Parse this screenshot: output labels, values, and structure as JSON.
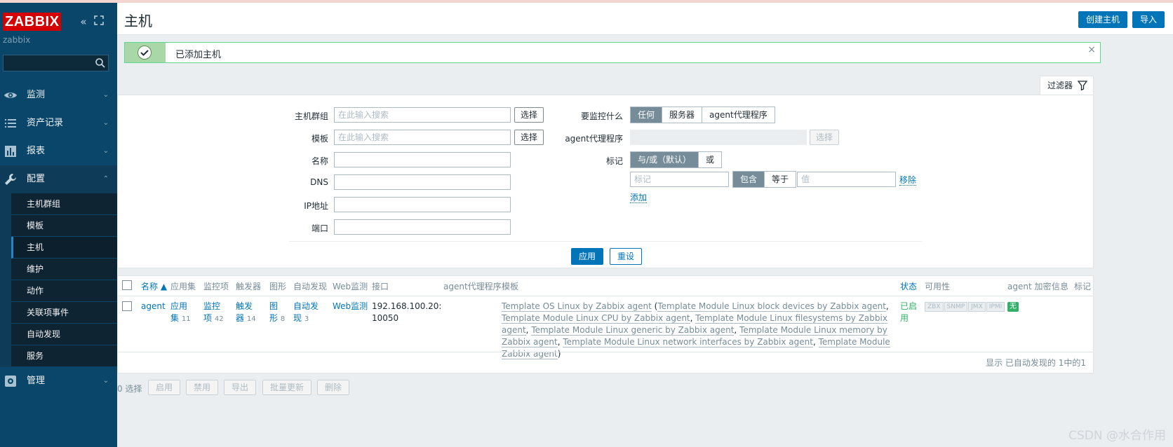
{
  "sidebar": {
    "logo": "ZABBIX",
    "server_name": "zabbix",
    "collapse_icon": "collapse-left-icon",
    "kiosk_icon": "fullscreen-icon",
    "search_placeholder": "",
    "menu": [
      {
        "label": "监测",
        "icon": "eye-icon"
      },
      {
        "label": "资产记录",
        "icon": "list-icon"
      },
      {
        "label": "报表",
        "icon": "bar-chart-icon"
      },
      {
        "label": "配置",
        "icon": "wrench-icon"
      }
    ],
    "submenu": [
      "主机群组",
      "模板",
      "主机",
      "维护",
      "动作",
      "关联项事件",
      "自动发现",
      "服务"
    ],
    "admin": {
      "label": "管理",
      "icon": "gear-icon"
    }
  },
  "header": {
    "title": "主机",
    "create_button": "创建主机",
    "import_button": "导入"
  },
  "message": {
    "text": "已添加主机",
    "close": "×",
    "success_color": "#59db8f"
  },
  "filter": {
    "tab_label": "过滤器",
    "host_groups_label": "主机群组",
    "host_groups_placeholder": "在此输入搜索",
    "templates_label": "模板",
    "templates_placeholder": "在此输入搜索",
    "select_button": "选择",
    "name_label": "名称",
    "dns_label": "DNS",
    "ip_label": "IP地址",
    "port_label": "端口",
    "monitored_by_label": "要监控什么",
    "monitored_by_options": [
      "任何",
      "服务器",
      "agent代理程序"
    ],
    "proxy_label": "agent代理程序",
    "proxy_select": "选择",
    "tags_label": "标记",
    "tags_mode_options": [
      "与/或（默认）",
      "或"
    ],
    "tag_placeholder": "标记",
    "tag_operator_options": [
      "包含",
      "等于"
    ],
    "value_placeholder": "值",
    "remove_link": "移除",
    "add_link": "添加",
    "apply_button": "应用",
    "reset_button": "重设"
  },
  "table": {
    "headers": {
      "name": "名称 ▲",
      "applications": "应用集",
      "items": "监控项",
      "triggers": "触发器",
      "graphs": "图形",
      "discovery": "自动发现",
      "web": "Web监测",
      "interface": "接口",
      "proxy": "agent代理程序",
      "templates": "模板",
      "status": "状态",
      "availability": "可用性",
      "encryption": "agent 加密",
      "info": "信息",
      "tags": "标记"
    },
    "row": {
      "name": "agent",
      "applications_l1": "应用",
      "applications_l2": "集",
      "applications_count": "11",
      "items_l1": "监控",
      "items_l2": "项",
      "items_count": "42",
      "triggers_l1": "触发",
      "triggers_l2": "器",
      "triggers_count": "14",
      "graphs_l1": "图",
      "graphs_l2": "形",
      "graphs_count": "8",
      "discovery_l1": "自动发",
      "discovery_l2": "现",
      "discovery_count": "3",
      "web": "Web监测",
      "interface_l1": "192.168.100.20:",
      "interface_l2": "10050",
      "template_main": "Template OS Linux by Zabbix agent",
      "template_children": [
        "Template Module Linux block devices by Zabbix agent",
        "Template Module Linux CPU by Zabbix agent",
        "Template Module Linux filesystems by Zabbix agent",
        "Template Module Linux generic by Zabbix agent",
        "Template Module Linux memory by Zabbix agent",
        "Template Module Linux network interfaces by Zabbix agent",
        "Template Module Zabbix agent"
      ],
      "status_l1": "已启",
      "status_l2": "用",
      "availability": [
        "ZBX",
        "SNMP",
        "JMX",
        "IPMI"
      ],
      "encryption": "无"
    },
    "footer": "显示 已自动发现的 1中的1"
  },
  "bottom": {
    "selected": "0 选择",
    "buttons": [
      "启用",
      "禁用",
      "导出",
      "批量更新",
      "删除"
    ]
  },
  "watermark": "CSDN @水合作用"
}
